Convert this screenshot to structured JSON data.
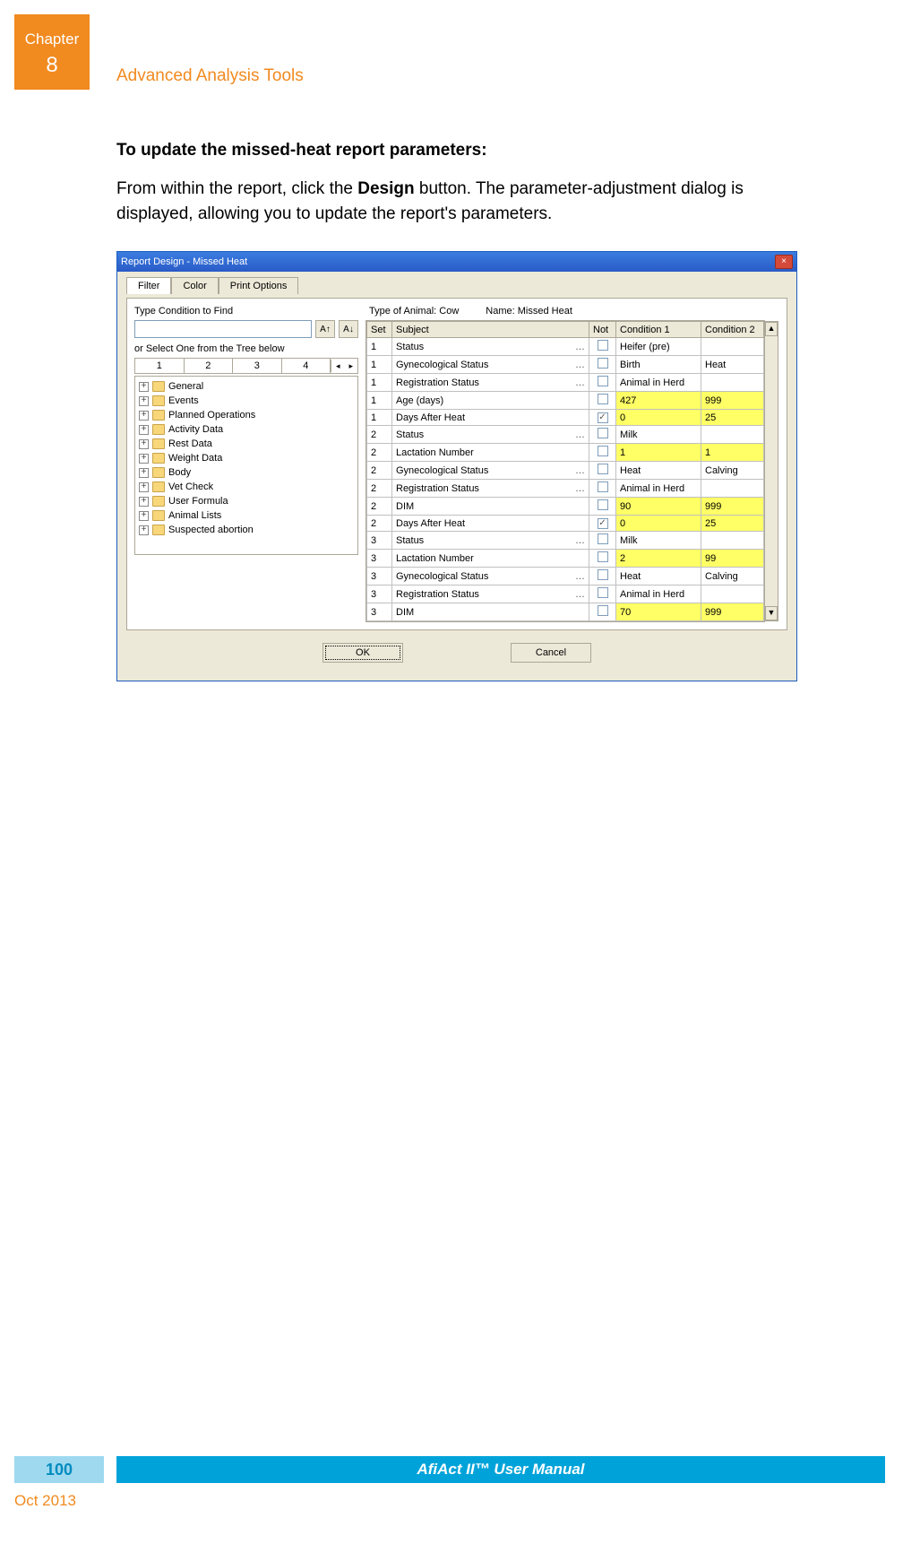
{
  "chapter": {
    "label": "Chapter",
    "number": "8"
  },
  "section_title": "Advanced Analysis Tools",
  "heading": "To update the missed-heat report parameters:",
  "paragraph_prefix": "From within the report, click the ",
  "paragraph_bold": "Design",
  "paragraph_suffix": " button. The parameter-adjustment dialog is displayed, allowing you to update the report's parameters.",
  "dialog": {
    "title": "Report Design - Missed Heat",
    "close": "×",
    "tabs": {
      "filter": "Filter",
      "color": "Color",
      "print": "Print Options"
    },
    "left": {
      "type_label": "Type Condition to Find",
      "up_btn": "A↑",
      "down_btn": "A↓",
      "or_label": "or Select One from the Tree below",
      "numtabs": [
        "1",
        "2",
        "3",
        "4"
      ],
      "tree": [
        "General",
        "Events",
        "Planned Operations",
        "Activity Data",
        "Rest Data",
        "Weight Data",
        "Body",
        "Vet Check",
        "User Formula",
        "Animal Lists",
        "Suspected abortion"
      ]
    },
    "right": {
      "type_of_animal_label": "Type of Animal:",
      "type_of_animal_value": "Cow",
      "name_label": "Name:",
      "name_value": "Missed Heat",
      "columns": {
        "set": "Set",
        "subject": "Subject",
        "not": "Not",
        "c1": "Condition 1",
        "c2": "Condition 2"
      },
      "rows": [
        {
          "set": "1",
          "subject": "Status",
          "dots": true,
          "chk": "",
          "c1": "Heifer (pre)",
          "c2": "",
          "hl1": false,
          "hl2": false
        },
        {
          "set": "1",
          "subject": "Gynecological Status",
          "dots": true,
          "chk": "",
          "c1": "Birth",
          "c2": "Heat",
          "hl1": false,
          "hl2": false
        },
        {
          "set": "1",
          "subject": "Registration Status",
          "dots": true,
          "chk": "",
          "c1": "Animal in Herd",
          "c2": "",
          "hl1": false,
          "hl2": false
        },
        {
          "set": "1",
          "subject": "Age (days)",
          "dots": false,
          "chk": "",
          "c1": "427",
          "c2": "999",
          "hl1": true,
          "hl2": true
        },
        {
          "set": "1",
          "subject": "Days After Heat",
          "dots": false,
          "chk": "✓",
          "c1": "0",
          "c2": "25",
          "hl1": true,
          "hl2": true
        },
        {
          "set": "2",
          "subject": "Status",
          "dots": true,
          "chk": "",
          "c1": "Milk",
          "c2": "",
          "hl1": false,
          "hl2": false
        },
        {
          "set": "2",
          "subject": "Lactation Number",
          "dots": false,
          "chk": "",
          "c1": "1",
          "c2": "1",
          "hl1": true,
          "hl2": true
        },
        {
          "set": "2",
          "subject": "Gynecological Status",
          "dots": true,
          "chk": "",
          "c1": "Heat",
          "c2": "Calving",
          "hl1": false,
          "hl2": false
        },
        {
          "set": "2",
          "subject": "Registration Status",
          "dots": true,
          "chk": "",
          "c1": "Animal in Herd",
          "c2": "",
          "hl1": false,
          "hl2": false
        },
        {
          "set": "2",
          "subject": "DIM",
          "dots": false,
          "chk": "",
          "c1": "90",
          "c2": "999",
          "hl1": true,
          "hl2": true
        },
        {
          "set": "2",
          "subject": "Days After Heat",
          "dots": false,
          "chk": "✓",
          "c1": "0",
          "c2": "25",
          "hl1": true,
          "hl2": true
        },
        {
          "set": "3",
          "subject": "Status",
          "dots": true,
          "chk": "",
          "c1": "Milk",
          "c2": "",
          "hl1": false,
          "hl2": false
        },
        {
          "set": "3",
          "subject": "Lactation Number",
          "dots": false,
          "chk": "",
          "c1": "2",
          "c2": "99",
          "hl1": true,
          "hl2": true
        },
        {
          "set": "3",
          "subject": "Gynecological Status",
          "dots": true,
          "chk": "",
          "c1": "Heat",
          "c2": "Calving",
          "hl1": false,
          "hl2": false
        },
        {
          "set": "3",
          "subject": "Registration Status",
          "dots": true,
          "chk": "",
          "c1": "Animal in Herd",
          "c2": "",
          "hl1": false,
          "hl2": false
        },
        {
          "set": "3",
          "subject": "DIM",
          "dots": false,
          "chk": "",
          "c1": "70",
          "c2": "999",
          "hl1": true,
          "hl2": true
        }
      ]
    },
    "buttons": {
      "ok": "OK",
      "cancel": "Cancel"
    }
  },
  "footer": {
    "page_number": "100",
    "manual_title": "AfiAct II™ User Manual",
    "date": "Oct 2013"
  }
}
